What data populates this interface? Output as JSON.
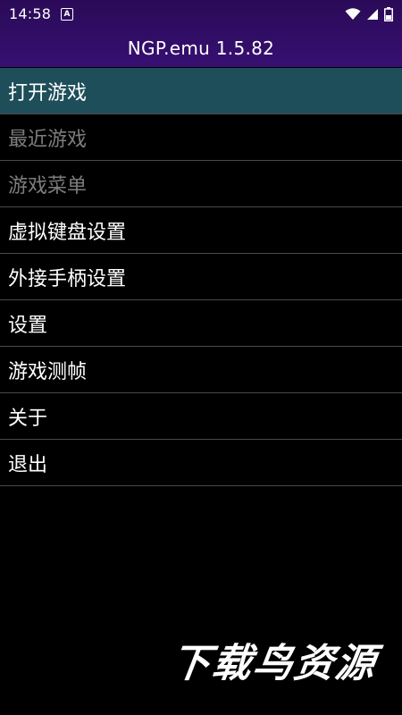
{
  "status_bar": {
    "time": "14:58",
    "app_icon_letter": "A",
    "icons": [
      "wifi-icon",
      "signal-icon",
      "battery-icon"
    ]
  },
  "app": {
    "title": "NGP.emu  1.5.82"
  },
  "menu": {
    "items": [
      {
        "label": "打开游戏",
        "state": "selected"
      },
      {
        "label": "最近游戏",
        "state": "disabled"
      },
      {
        "label": "游戏菜单",
        "state": "disabled"
      },
      {
        "label": "虚拟键盘设置",
        "state": "enabled"
      },
      {
        "label": "外接手柄设置",
        "state": "enabled"
      },
      {
        "label": "设置",
        "state": "enabled"
      },
      {
        "label": "游戏测帧",
        "state": "enabled"
      },
      {
        "label": "关于",
        "state": "enabled"
      },
      {
        "label": "退出",
        "state": "enabled"
      }
    ]
  },
  "watermark": "下载鸟资源",
  "colors": {
    "header_gradient_top": "#2a0a57",
    "header_gradient_bottom": "#371072",
    "selected_row": "#1e4e5a",
    "disabled_text": "#7d7d7d",
    "divider": "#4a4a4a",
    "background": "#000000"
  }
}
